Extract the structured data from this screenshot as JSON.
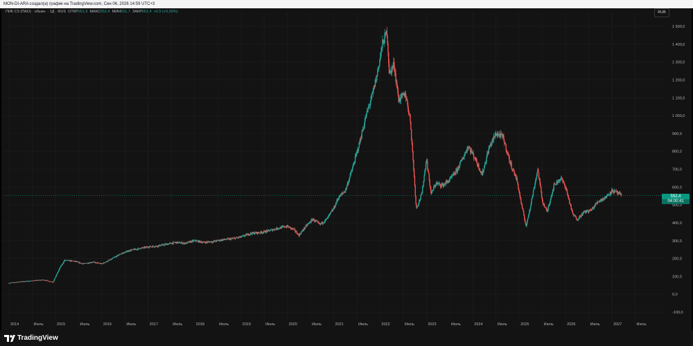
{
  "header": {
    "text": "MON-DI-ARA создал(а) график на TradingView.com, Сен 06, 2026 14:59 UTC+3"
  },
  "legend": {
    "symbol": "ПИК СЗ (ПАО) · обыкн. · 1Д · RUS",
    "open_label": "ОТКР",
    "open_value": "551,9",
    "high_label": "МАКС",
    "high_value": "552,4",
    "low_label": "МИН",
    "low_value": "551,7",
    "close_label": "ЗАКР",
    "close_value": "552,4",
    "change": "+0,5 (+0,09%)"
  },
  "currency": "RUB",
  "price_badge": {
    "price": "552,4",
    "countdown": "04:00:41"
  },
  "logo_text": "TradingView",
  "colors": {
    "up": "#26a69a",
    "down": "#ef5350",
    "background": "#131313",
    "grid": "#1f1f1f",
    "badge": "#089981"
  },
  "chart_data": {
    "type": "candlestick",
    "y_axis_ticks": [
      "1 500,0",
      "1 400,0",
      "1 300,0",
      "1 200,0",
      "1 100,0",
      "1 000,0",
      "900,0",
      "800,0",
      "700,0",
      "600,0",
      "500,0",
      "400,0",
      "300,0",
      "200,0",
      "100,0",
      "0,0",
      "-100,0"
    ],
    "ylim": [
      -100,
      1500
    ],
    "x_axis_ticks": [
      "2014",
      "Июль",
      "2015",
      "Июль",
      "2016",
      "Июль",
      "2017",
      "Июль",
      "2018",
      "Июль",
      "2019",
      "Июль",
      "2020",
      "Июль",
      "2021",
      "Июль",
      "2022",
      "Июль",
      "2023",
      "Июль",
      "2024",
      "Июль",
      "2025",
      "Июль",
      "2026",
      "Июль",
      "2027",
      "Июль"
    ],
    "series": [
      {
        "values_t_price": [
          [
            2014.0,
            62
          ],
          [
            2014.25,
            70
          ],
          [
            2014.5,
            75
          ],
          [
            2014.75,
            80
          ],
          [
            2014.95,
            68
          ],
          [
            2015.1,
            150
          ],
          [
            2015.2,
            190
          ],
          [
            2015.4,
            185
          ],
          [
            2015.6,
            170
          ],
          [
            2015.8,
            180
          ],
          [
            2016.0,
            170
          ],
          [
            2016.2,
            195
          ],
          [
            2016.4,
            225
          ],
          [
            2016.6,
            245
          ],
          [
            2016.8,
            255
          ],
          [
            2017.0,
            265
          ],
          [
            2017.2,
            270
          ],
          [
            2017.4,
            280
          ],
          [
            2017.6,
            290
          ],
          [
            2017.8,
            285
          ],
          [
            2018.0,
            300
          ],
          [
            2018.2,
            290
          ],
          [
            2018.4,
            295
          ],
          [
            2018.6,
            305
          ],
          [
            2018.8,
            310
          ],
          [
            2019.0,
            320
          ],
          [
            2019.2,
            340
          ],
          [
            2019.4,
            345
          ],
          [
            2019.6,
            355
          ],
          [
            2019.8,
            370
          ],
          [
            2020.0,
            380
          ],
          [
            2020.15,
            360
          ],
          [
            2020.25,
            330
          ],
          [
            2020.4,
            380
          ],
          [
            2020.55,
            420
          ],
          [
            2020.7,
            390
          ],
          [
            2020.85,
            420
          ],
          [
            2021.0,
            480
          ],
          [
            2021.1,
            540
          ],
          [
            2021.25,
            580
          ],
          [
            2021.4,
            700
          ],
          [
            2021.55,
            840
          ],
          [
            2021.7,
            1000
          ],
          [
            2021.85,
            1130
          ],
          [
            2021.95,
            1250
          ],
          [
            2022.05,
            1400
          ],
          [
            2022.15,
            1470
          ],
          [
            2022.2,
            1230
          ],
          [
            2022.3,
            1290
          ],
          [
            2022.4,
            1090
          ],
          [
            2022.55,
            1120
          ],
          [
            2022.65,
            980
          ],
          [
            2022.72,
            720
          ],
          [
            2022.78,
            480
          ],
          [
            2022.9,
            560
          ],
          [
            2023.0,
            760
          ],
          [
            2023.1,
            560
          ],
          [
            2023.2,
            620
          ],
          [
            2023.35,
            610
          ],
          [
            2023.5,
            640
          ],
          [
            2023.65,
            690
          ],
          [
            2023.8,
            770
          ],
          [
            2023.9,
            830
          ],
          [
            2024.05,
            760
          ],
          [
            2024.2,
            670
          ],
          [
            2024.35,
            820
          ],
          [
            2024.5,
            900
          ],
          [
            2024.65,
            880
          ],
          [
            2024.8,
            740
          ],
          [
            2024.95,
            640
          ],
          [
            2025.05,
            500
          ],
          [
            2025.15,
            380
          ],
          [
            2025.3,
            570
          ],
          [
            2025.4,
            700
          ],
          [
            2025.5,
            520
          ],
          [
            2025.6,
            460
          ],
          [
            2025.75,
            610
          ],
          [
            2025.9,
            650
          ],
          [
            2026.0,
            600
          ],
          [
            2026.15,
            450
          ],
          [
            2026.25,
            420
          ],
          [
            2026.4,
            460
          ],
          [
            2026.55,
            470
          ],
          [
            2026.7,
            520
          ],
          [
            2026.85,
            540
          ],
          [
            2027.0,
            580
          ],
          [
            2027.1,
            570
          ],
          [
            2027.2,
            552
          ]
        ]
      }
    ],
    "last_price": 552.4
  }
}
